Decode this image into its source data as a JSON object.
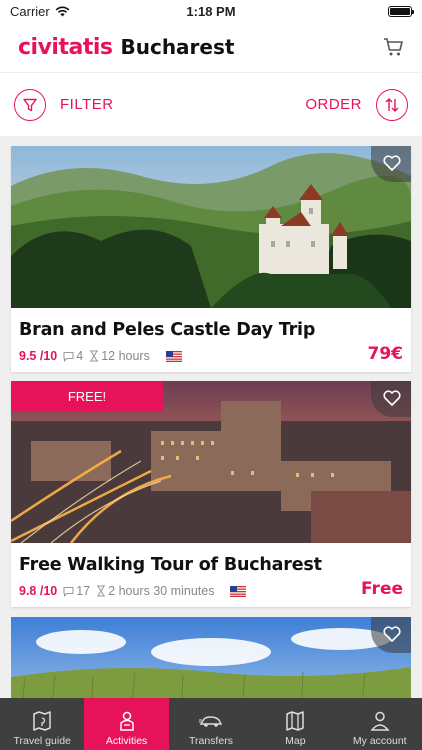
{
  "status": {
    "carrier": "Carrier",
    "time": "1:18 PM"
  },
  "header": {
    "brand": "civitatis",
    "city": "Bucharest",
    "cart_icon": "cart-icon"
  },
  "filter_bar": {
    "filter_label": "FILTER",
    "order_label": "ORDER"
  },
  "colors": {
    "accent": "#e6135a",
    "tabbar": "#3f3f3f"
  },
  "cards": [
    {
      "title": "Bran and Peles Castle Day Trip",
      "rating": "9.5 /10",
      "reviews": "4",
      "duration": "12 hours",
      "price": "79€",
      "badge": ""
    },
    {
      "title": "Free Walking Tour of Bucharest",
      "rating": "9.8 /10",
      "reviews": "17",
      "duration": "2 hours 30 minutes",
      "price": "Free",
      "badge": "FREE!"
    }
  ],
  "tabs": [
    {
      "label": "Travel guide",
      "icon": "map-book-icon"
    },
    {
      "label": "Activities",
      "icon": "person-icon",
      "active": true
    },
    {
      "label": "Transfers",
      "icon": "car-icon"
    },
    {
      "label": "Map",
      "icon": "map-icon"
    },
    {
      "label": "My account",
      "icon": "account-icon"
    }
  ]
}
